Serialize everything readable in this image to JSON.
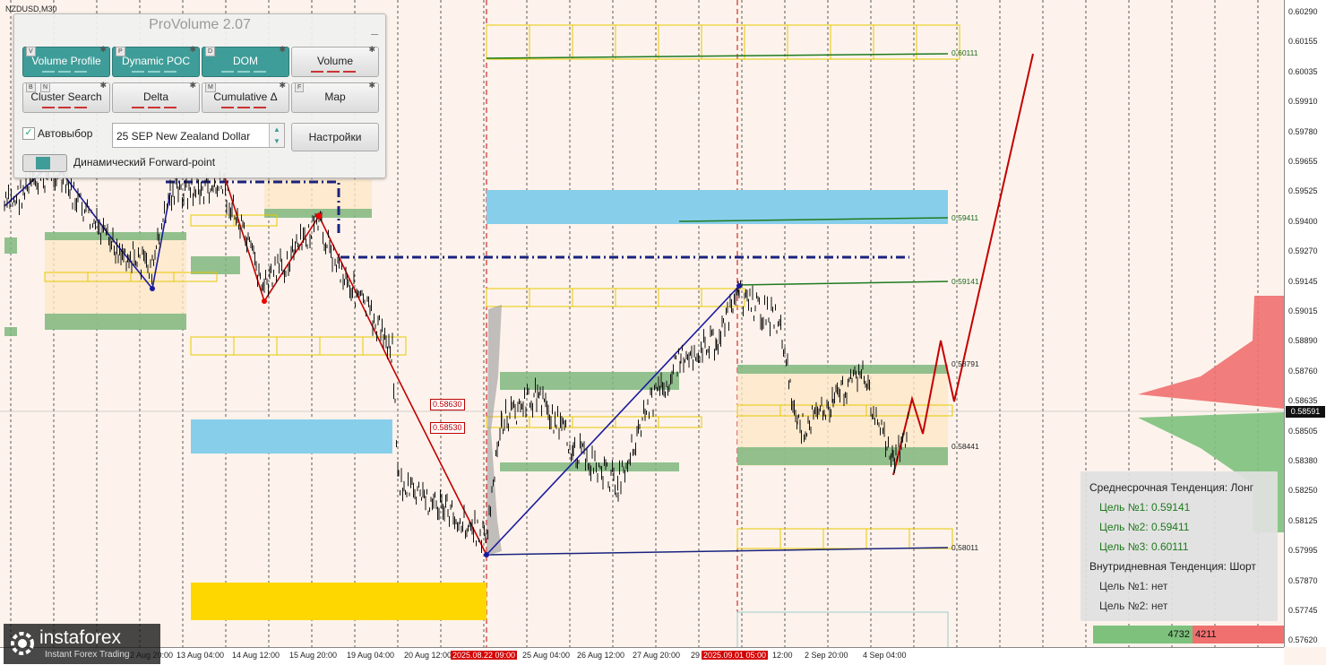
{
  "symbol": "NZDUSD,M30",
  "panel": {
    "title": "ProVolume 2.07",
    "minimize": "_",
    "buttons": [
      {
        "label": "Volume Profile",
        "key": "V",
        "active": true
      },
      {
        "label": "Dynamic POC",
        "key": "P",
        "active": true
      },
      {
        "label": "DOM",
        "key": "D",
        "active": true
      },
      {
        "label": "Volume",
        "key": "",
        "active": false
      },
      {
        "label": "Cluster Search",
        "key": "B",
        "key2": "N",
        "active": false
      },
      {
        "label": "Delta",
        "key": "",
        "active": false
      },
      {
        "label": "Cumulative Δ",
        "key": "M",
        "active": false
      },
      {
        "label": "Map",
        "key": "F",
        "active": false
      }
    ],
    "autoselect_label": "Автовыбор",
    "autoselect_checked": true,
    "contract_value": "25 SEP New Zealand Dollar",
    "settings_label": "Настройки",
    "forward_label": "Динамический Forward-point"
  },
  "price_axis": {
    "ticks": [
      "0.60290",
      "0.60155",
      "0.60035",
      "0.59910",
      "0.59780",
      "0.59655",
      "0.59525",
      "0.59400",
      "0.59270",
      "0.59145",
      "0.59015",
      "0.58890",
      "0.58760",
      "0.58635",
      "0.58505",
      "0.58380",
      "0.58250",
      "0.58125",
      "0.57995",
      "0.57870",
      "0.57745",
      "0.57620"
    ],
    "current": "0.58591"
  },
  "time_axis": {
    "ticks": [
      {
        "label": "12 Aug 20:00",
        "highlight": false
      },
      {
        "label": "13 Aug 04:00",
        "highlight": false
      },
      {
        "label": "14 Aug 12:00",
        "highlight": false
      },
      {
        "label": "15 Aug 20:00",
        "highlight": false
      },
      {
        "label": "19 Aug 04:00",
        "highlight": false
      },
      {
        "label": "20 Aug 12:00",
        "highlight": false
      },
      {
        "label": "2025.08.22 09:00",
        "highlight": true
      },
      {
        "label": "25 Aug 04:00",
        "highlight": false
      },
      {
        "label": "26 Aug 12:00",
        "highlight": false
      },
      {
        "label": "27 Aug 20:00",
        "highlight": false
      },
      {
        "label": "29",
        "highlight": false
      },
      {
        "label": "2025.09.01 05:00",
        "highlight": true
      },
      {
        "label": "12:00",
        "highlight": false
      },
      {
        "label": "2 Sep 20:00",
        "highlight": false
      },
      {
        "label": "4 Sep 04:00",
        "highlight": false
      }
    ]
  },
  "levels": {
    "l1": "0.60111",
    "l2": "0.59411",
    "l3": "0.59141",
    "l4": "0.58791",
    "l5": "0.58441",
    "l6": "0.58011",
    "box1": "0.58630",
    "box2": "0.58530"
  },
  "trend": {
    "medium_title": "Среднесрочная Тенденция: Лонг",
    "target1": "Цель №1: 0.59141",
    "target2": "Цель №2: 0.59411",
    "target3": "Цель №3: 0.60111",
    "intraday_title": "Внутридневная Тенденция: Шорт",
    "intraday1": "Цель №1: нет",
    "intraday2": "Цель №2: нет"
  },
  "volume": {
    "buy": "4732",
    "sell": "4211"
  },
  "logo": {
    "name": "instaforex",
    "tagline": "Instant Forex Trading"
  },
  "colors": {
    "buy": "#7dc17d",
    "sell": "#f07070",
    "accent": "#3f9d99",
    "zone_blue": "#87ceeb",
    "zone_gold": "#ffd700"
  }
}
